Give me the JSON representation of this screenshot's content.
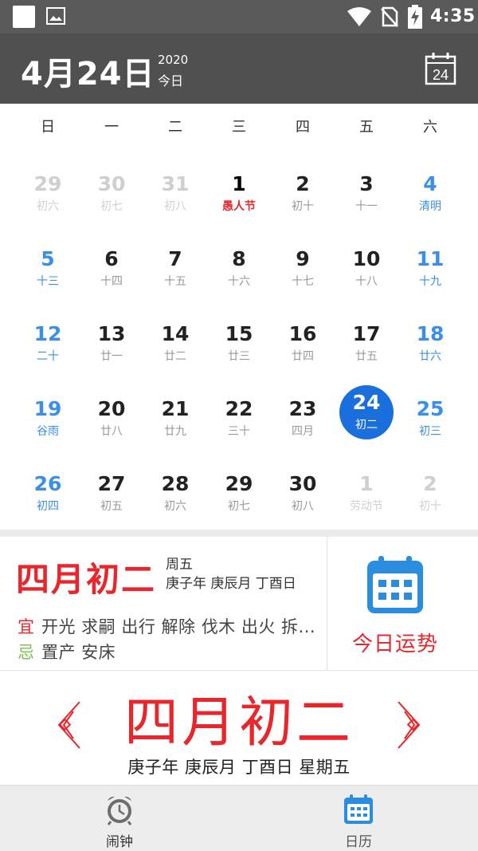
{
  "status_bar": {
    "time": "4:35"
  },
  "header": {
    "date": "4月24日",
    "year": "2020",
    "today_label": "今日",
    "calendar_button_day": "24"
  },
  "weekdays": [
    "日",
    "一",
    "二",
    "三",
    "四",
    "五",
    "六"
  ],
  "calendar_days": [
    {
      "num": "29",
      "lunar": "初六",
      "type": "other"
    },
    {
      "num": "30",
      "lunar": "初七",
      "type": "other"
    },
    {
      "num": "31",
      "lunar": "初八",
      "type": "other"
    },
    {
      "num": "1",
      "lunar": "愚人节",
      "type": "holiday"
    },
    {
      "num": "2",
      "lunar": "初十",
      "type": "normal"
    },
    {
      "num": "3",
      "lunar": "十一",
      "type": "normal"
    },
    {
      "num": "4",
      "lunar": "清明",
      "type": "weekend"
    },
    {
      "num": "5",
      "lunar": "十三",
      "type": "weekend"
    },
    {
      "num": "6",
      "lunar": "十四",
      "type": "normal"
    },
    {
      "num": "7",
      "lunar": "十五",
      "type": "normal"
    },
    {
      "num": "8",
      "lunar": "十六",
      "type": "normal"
    },
    {
      "num": "9",
      "lunar": "十七",
      "type": "normal"
    },
    {
      "num": "10",
      "lunar": "十八",
      "type": "normal"
    },
    {
      "num": "11",
      "lunar": "十九",
      "type": "weekend"
    },
    {
      "num": "12",
      "lunar": "二十",
      "type": "weekend"
    },
    {
      "num": "13",
      "lunar": "廿一",
      "type": "normal"
    },
    {
      "num": "14",
      "lunar": "廿二",
      "type": "normal"
    },
    {
      "num": "15",
      "lunar": "廿三",
      "type": "normal"
    },
    {
      "num": "16",
      "lunar": "廿四",
      "type": "normal"
    },
    {
      "num": "17",
      "lunar": "廿五",
      "type": "normal"
    },
    {
      "num": "18",
      "lunar": "廿六",
      "type": "weekend"
    },
    {
      "num": "19",
      "lunar": "谷雨",
      "type": "weekend"
    },
    {
      "num": "20",
      "lunar": "廿八",
      "type": "normal"
    },
    {
      "num": "21",
      "lunar": "廿九",
      "type": "normal"
    },
    {
      "num": "22",
      "lunar": "三十",
      "type": "normal"
    },
    {
      "num": "23",
      "lunar": "四月",
      "type": "normal"
    },
    {
      "num": "24",
      "lunar": "初二",
      "type": "selected"
    },
    {
      "num": "25",
      "lunar": "初三",
      "type": "weekend"
    },
    {
      "num": "26",
      "lunar": "初四",
      "type": "weekend"
    },
    {
      "num": "27",
      "lunar": "初五",
      "type": "normal"
    },
    {
      "num": "28",
      "lunar": "初六",
      "type": "normal"
    },
    {
      "num": "29",
      "lunar": "初七",
      "type": "normal"
    },
    {
      "num": "30",
      "lunar": "初八",
      "type": "normal"
    },
    {
      "num": "1",
      "lunar": "劳动节",
      "type": "other"
    },
    {
      "num": "2",
      "lunar": "初十",
      "type": "other"
    }
  ],
  "almanac": {
    "lunar_date": "四月初二",
    "weekday": "周五",
    "ganzhi": "庚子年 庚辰月 丁酉日",
    "yi_label": "宜",
    "yi": "开光 求嗣 出行 解除 伐木 出火 拆...",
    "ji_label": "忌",
    "ji": "置产 安床",
    "fortune_label": "今日运势"
  },
  "banner": {
    "lunar_date": "四月初二",
    "subtitle": "庚子年 庚辰月 丁酉日 星期五"
  },
  "nav": {
    "alarm_label": "闹钟",
    "calendar_label": "日历"
  },
  "colors": {
    "accent_red": "#e8262b",
    "selected_blue": "#1a6fdc",
    "weekend_blue": "#3b8fe8",
    "yi_green": "#79c24b",
    "header_gray": "#505050"
  }
}
